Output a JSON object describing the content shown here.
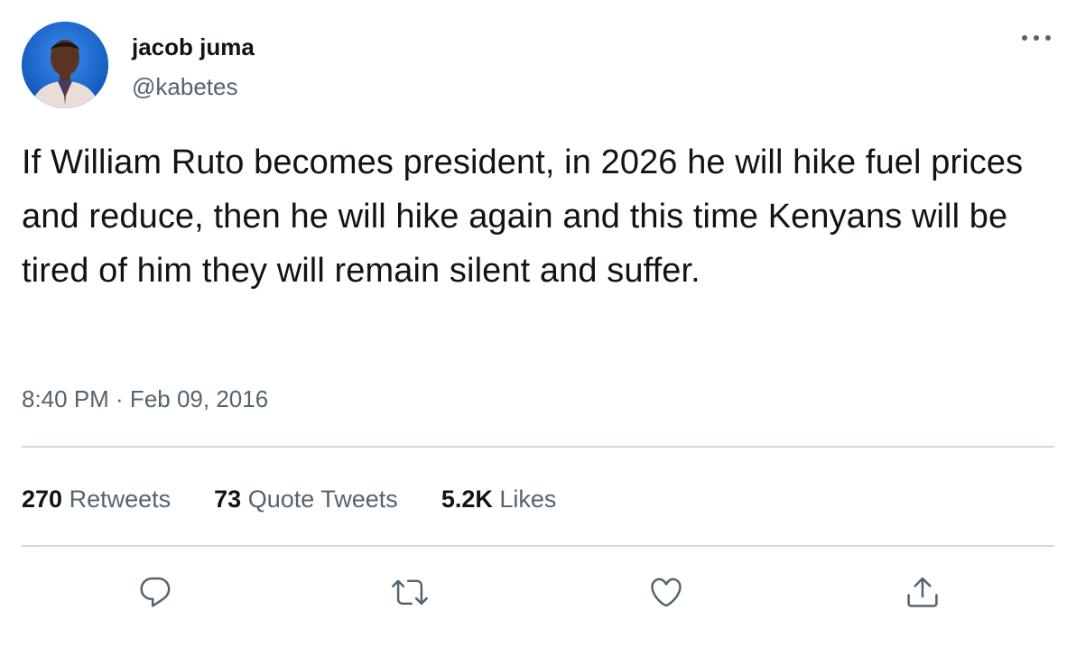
{
  "user": {
    "display_name": "jacob juma",
    "handle": "@kabetes"
  },
  "tweet": {
    "text": "If William Ruto becomes president, in 2026 he will hike fuel prices and reduce, then he will hike again and this time Kenyans will be tired of him they will remain silent and suffer.",
    "timestamp": "8:40 PM · Feb 09, 2016"
  },
  "stats": {
    "retweets_count": "270",
    "retweets_label": "Retweets",
    "quotes_count": "73",
    "quotes_label": "Quote Tweets",
    "likes_count": "5.2K",
    "likes_label": "Likes"
  },
  "icons": {
    "more": "more-icon",
    "reply": "reply-icon",
    "retweet": "retweet-icon",
    "like": "heart-icon",
    "share": "share-icon"
  },
  "colors": {
    "text_primary": "#0f1419",
    "text_secondary": "#536471",
    "divider": "#cfd9de"
  }
}
